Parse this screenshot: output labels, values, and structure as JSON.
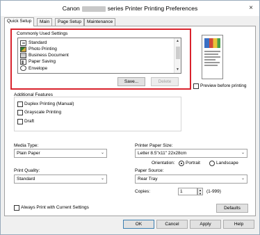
{
  "window": {
    "title_prefix": "Canon",
    "title_suffix": "series Printer Printing Preferences",
    "close": "×"
  },
  "tabs": [
    {
      "label": "Quick Setup"
    },
    {
      "label": "Main"
    },
    {
      "label": "Page Setup"
    },
    {
      "label": "Maintenance"
    }
  ],
  "commonly_used": {
    "label": "Commonly Used Settings",
    "items": [
      "Standard",
      "Photo Printing",
      "Business Document",
      "Paper Saving",
      "Envelope"
    ],
    "save_label": "Save...",
    "delete_label": "Delete"
  },
  "preview": {
    "checkbox_label": "Preview before printing"
  },
  "features": {
    "label": "Additional Features",
    "items": [
      "Duplex Printing (Manual)",
      "Grayscale Printing",
      "Draft"
    ]
  },
  "media_type": {
    "label": "Media Type:",
    "value": "Plain Paper"
  },
  "printer_paper_size": {
    "label": "Printer Paper Size:",
    "value": "Letter 8.5\"x11\" 22x28cm"
  },
  "orientation": {
    "label": "Orientation:",
    "portrait": "Portrait",
    "landscape": "Landscape"
  },
  "print_quality": {
    "label": "Print Quality:",
    "value": "Standard"
  },
  "paper_source": {
    "label": "Paper Source:",
    "value": "Rear Tray"
  },
  "copies": {
    "label": "Copies:",
    "value": "1",
    "range": "(1-999)"
  },
  "always_print": {
    "label": "Always Print with Current Settings"
  },
  "defaults_label": "Defaults",
  "footer": {
    "ok": "OK",
    "cancel": "Cancel",
    "apply": "Apply",
    "help": "Help"
  }
}
